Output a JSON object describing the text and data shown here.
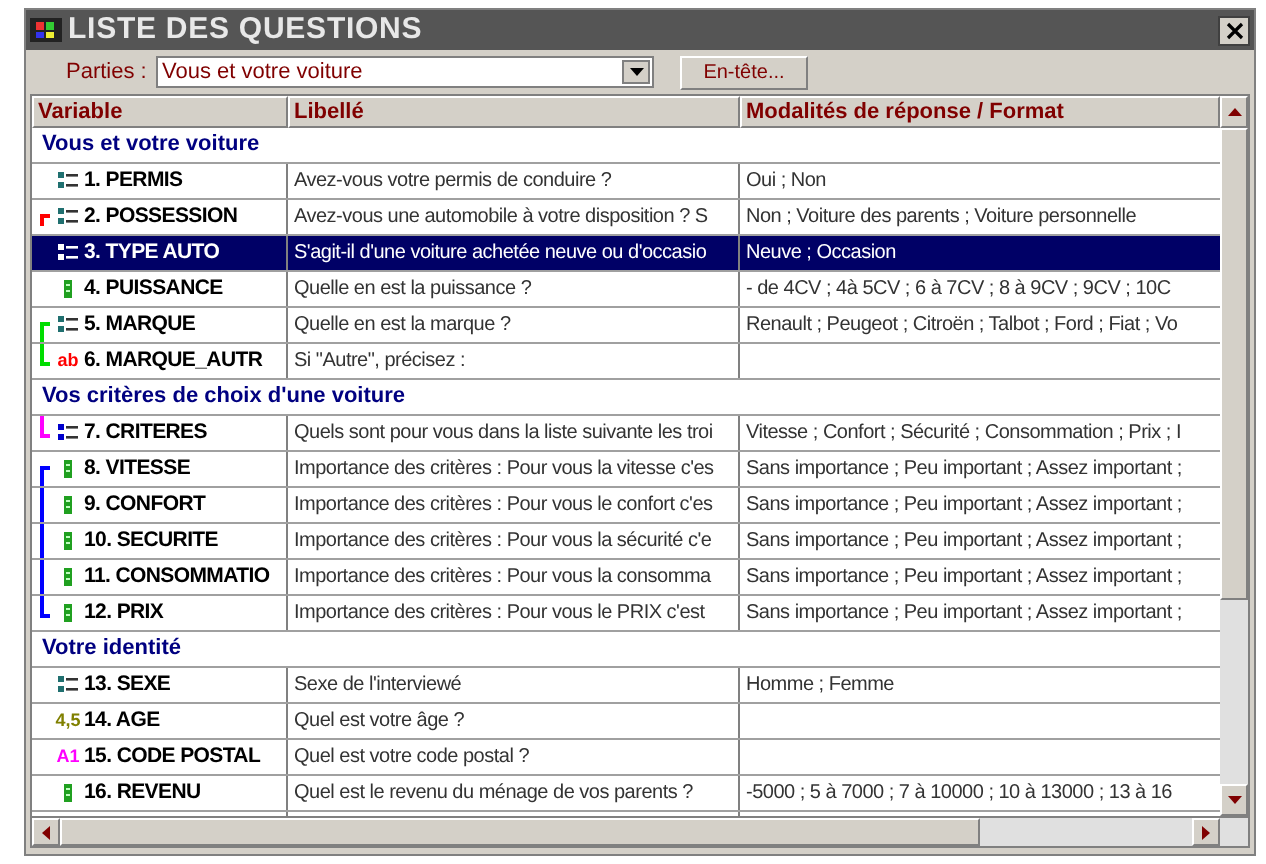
{
  "window": {
    "title": "LISTE DES QUESTIONS"
  },
  "parts": {
    "label": "Parties :",
    "value": "Vous et votre voiture"
  },
  "header_button": "En-tête...",
  "table": {
    "columns": [
      "Variable",
      "Libellé",
      "Modalités de réponse / Format"
    ],
    "sections": [
      {
        "title": "Vous et votre voiture",
        "questions": [
          {
            "kind": "single",
            "variable": "1. PERMIS",
            "label": "Avez-vous votre permis de conduire ?",
            "format": "Oui ; Non",
            "selected": false
          },
          {
            "kind": "single",
            "variable": "2. POSSESSION",
            "label": "Avez-vous une automobile à votre disposition ? S",
            "format": "Non ; Voiture des parents ; Voiture personnelle",
            "selected": false,
            "link_start": true,
            "color": "#ff0000"
          },
          {
            "kind": "single",
            "variable": "3. TYPE AUTO",
            "label": "S'agit-il d'une voiture achetée neuve ou d'occasio",
            "format": "Neuve ; Occasion",
            "selected": true
          },
          {
            "kind": "numeric",
            "variable": "4. PUISSANCE",
            "label": "Quelle en est la puissance ?",
            "format": "- de 4CV ; 4à 5CV ; 6 à 7CV ; 8 à 9CV ; 9CV ; 10C",
            "selected": false
          },
          {
            "kind": "single",
            "variable": "5. MARQUE",
            "label": "Quelle en est la marque ?",
            "format": "Renault ; Peugeot ; Citroën ; Talbot ; Ford ; Fiat ; Vo",
            "selected": false,
            "link_start": true,
            "color": "#00dd00"
          },
          {
            "kind": "text",
            "badge": "ab",
            "variable": "6. MARQUE_AUTR",
            "label": "Si \"Autre\", précisez :",
            "selected": false,
            "link_end": true,
            "color": "#00dd00"
          }
        ]
      },
      {
        "title": "Vos critères de choix d'une voiture",
        "questions": [
          {
            "kind": "multiple",
            "variable": "7. CRITERES",
            "label": "Quels sont pour vous dans la liste suivante les troi",
            "format": "Vitesse ; Confort ; Sécurité ; Consommation ; Prix ; I",
            "selected": false,
            "link_end": true,
            "color": "#ff00ff"
          },
          {
            "kind": "numeric",
            "variable": "8. VITESSE",
            "label": "Importance des critères : Pour vous la vitesse c'es",
            "format": "Sans importance ; Peu important ; Assez important ;",
            "selected": false,
            "link_start": true,
            "color": "#0000ff"
          },
          {
            "kind": "numeric",
            "variable": "9. CONFORT",
            "label": "Importance des critères : Pour vous le confort c'es",
            "format": "Sans importance ; Peu important ; Assez important ;",
            "selected": false,
            "color": "#0000ff"
          },
          {
            "kind": "numeric",
            "variable": "10. SECURITE",
            "label": "Importance des critères : Pour vous la sécurité c'e",
            "format": "Sans importance ; Peu important ; Assez important ;",
            "selected": false,
            "color": "#0000ff"
          },
          {
            "kind": "numeric",
            "variable": "11. CONSOMMATIO",
            "label": "Importance des critères : Pour vous la consomma",
            "format": "Sans importance ; Peu important ; Assez important ;",
            "selected": false,
            "color": "#0000ff"
          },
          {
            "kind": "numeric",
            "variable": "12. PRIX",
            "label": "Importance des critères : Pour vous le PRIX c'est",
            "format": "Sans importance ; Peu important ; Assez important ;",
            "selected": false,
            "link_end": true,
            "color": "#0000ff"
          }
        ]
      },
      {
        "title": "Votre identité",
        "questions": [
          {
            "kind": "single",
            "variable": "13. SEXE",
            "label": "Sexe de l'interviewé",
            "format": "Homme ; Femme",
            "selected": false
          },
          {
            "kind": "number",
            "badge": "4,5",
            "variable": "14. AGE",
            "label": "Quel est votre âge ?",
            "selected": false
          },
          {
            "kind": "code",
            "badge": "A1",
            "variable": "15. CODE POSTAL",
            "label": "Quel est votre code postal ?",
            "selected": false
          },
          {
            "kind": "numeric",
            "variable": "16. REVENU",
            "label": "Quel est le revenu du ménage de vos parents ?",
            "format": "-5000 ; 5 à 7000 ; 7 à 10000 ; 10 à 13000 ; 13 à 16",
            "selected": false
          }
        ]
      }
    ]
  }
}
